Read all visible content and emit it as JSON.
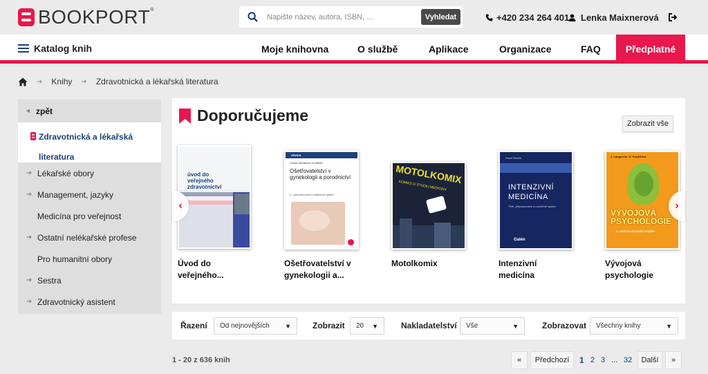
{
  "brand": {
    "name": "BOOKPORT",
    "reg": "®",
    "accent": "#e8174c",
    "navy": "#1d3f7c"
  },
  "search": {
    "placeholder": "Napište název, autora, ISBN, ...",
    "button": "Vyhledat"
  },
  "header": {
    "phone": "+420 234 264 401",
    "user": "Lenka Maixnerová"
  },
  "nav": {
    "catalog": "Katalog knih",
    "items": [
      "Moje knihovna",
      "O službě",
      "Aplikace",
      "Organizace",
      "FAQ"
    ],
    "cta": "Předplatné"
  },
  "breadcrumb": [
    "Knihy",
    "Zdravotnická a lékařská literatura"
  ],
  "sidebar": {
    "back": "zpět",
    "active_line1": "Zdravotnická a lékařská",
    "active_line2": "literatura",
    "items": [
      {
        "label": "Lékařské obory",
        "arrow": true
      },
      {
        "label": "Management, jazyky",
        "arrow": true
      },
      {
        "label": "Medicína pro veřejnost",
        "arrow": false
      },
      {
        "label": "Ostatní nelékařské profese",
        "arrow": true
      },
      {
        "label": "Pro humanitní obory",
        "arrow": false
      },
      {
        "label": "Sestra",
        "arrow": true
      },
      {
        "label": "Zdravotnický asistent",
        "arrow": true
      }
    ]
  },
  "recommended": {
    "title": "Doporučujeme",
    "show_all": "Zobrazit vše",
    "books": [
      {
        "title_l1": "Úvod do",
        "title_l2": "veřejného...",
        "cover_text": "úvod do veřejného zdravotnictví"
      },
      {
        "title_l1": "Ošetřovatelství v",
        "title_l2": "gynekologii a...",
        "cover_text": "Ošetřovatelství v gynekologii a porodnictví",
        "cover_sub": "2., přepracované a doplněné vydání",
        "cover_author": "Lenka Slezáková a kolektiv",
        "cover_publisher": "GRADA"
      },
      {
        "title_l1": "Motolkomix",
        "title_l2": "",
        "cover_text": "MOTOLKOMIX",
        "cover_sub": "KOMIKS O STUDIU MEDICÍNY"
      },
      {
        "title_l1": "Intenzivní",
        "title_l2": "medicína",
        "cover_text": "INTENZIVNÍ MEDICÍNA",
        "cover_sub": "Třetí, přepracované a rozšířené vydání",
        "cover_author": "Pavel Ševčík",
        "cover_publisher": "Galén"
      },
      {
        "title_l1": "Vývojová",
        "title_l2": "psychologie",
        "cover_text": "VÝVOJOVÁ PSYCHOLOGIE",
        "cover_sub": "2., AKTUALIZOVANÉ VYDÁNÍ",
        "cover_author": "J. Langmeier, D. Krejčířová"
      }
    ]
  },
  "filters": {
    "sort_label": "Řazení",
    "sort_value": "Od nejnovějších",
    "show_label": "Zobrazit",
    "show_value": "20",
    "publisher_label": "Nakladatelství",
    "publisher_value": "Vše",
    "display_label": "Zobrazovat",
    "display_value": "Všechny knihy"
  },
  "results": {
    "count": "1 - 20 z 636 knih"
  },
  "pagination": {
    "first": "«",
    "prev": "Předchozí",
    "pages": [
      "1",
      "2",
      "3",
      "...",
      "32"
    ],
    "next": "Další",
    "last": "»"
  }
}
